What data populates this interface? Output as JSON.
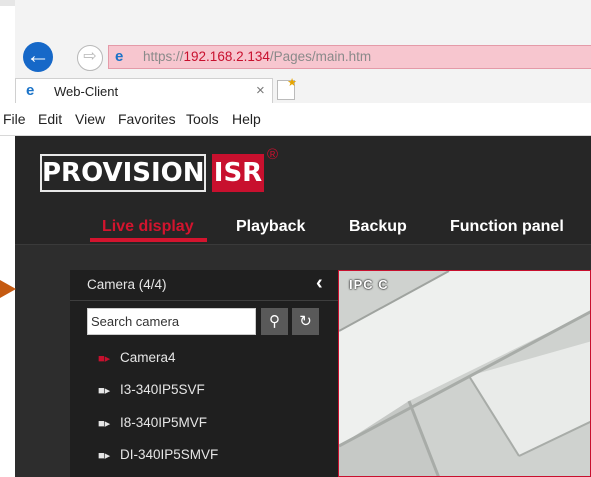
{
  "browser": {
    "url_prefix": "https://",
    "url_host": "192.168.2.134",
    "url_path": "/Pages/main.htm",
    "tab_title": "Web-Client",
    "tab_close": "×",
    "menu": [
      "File",
      "Edit",
      "View",
      "Favorites",
      "Tools",
      "Help"
    ]
  },
  "app": {
    "logo_main": "PROVISION",
    "logo_accent": "ISR",
    "logo_reg": "®",
    "nav": [
      "Live display",
      "Playback",
      "Backup",
      "Function panel"
    ],
    "active_nav": "Live display",
    "accent_color": "#d3142e"
  },
  "camera_panel": {
    "title": "Camera (4/4)",
    "search_placeholder": "Search camera",
    "cameras": [
      {
        "name": "Camera4",
        "status": "offline"
      },
      {
        "name": "I3-340IP5SVF",
        "status": "online"
      },
      {
        "name": "I8-340IP5MVF",
        "status": "online"
      },
      {
        "name": "DI-340IP5SMVF",
        "status": "online"
      }
    ]
  },
  "video": {
    "badge": "IPC C"
  },
  "icons": {
    "back": "back-arrow-icon",
    "forward": "forward-arrow-icon",
    "search": "search-icon",
    "refresh": "refresh-icon",
    "collapse": "chevron-left-icon",
    "camera": "camera-icon"
  }
}
